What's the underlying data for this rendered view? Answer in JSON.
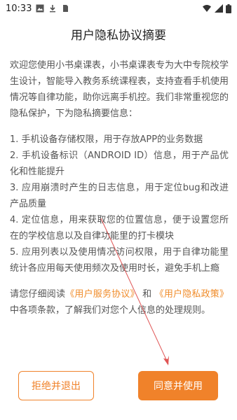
{
  "status_bar": {
    "time": "10:33"
  },
  "dialog": {
    "title": "用户隐私协议摘要",
    "intro": "欢迎您使用小书桌课表，小书桌课表专为大中专院校学生设计，智能导入教务系统课程表，支持查看手机使用情况等自律功能，助你远离手机控。我们非常重视您的隐私保护，下为隐私摘要信息：",
    "items": [
      "1. 手机设备存储权限，用于存放APP的业务数据",
      "2. 手机设备标识（ANDROID ID）信息，用于产品优化和性能提升",
      "3. 应用崩溃时产生的日志信息，用于定位bug和改进产品质量",
      "4. 定位信息，用来获取您的位置信息，便于设置您所在的学校信息以及自律功能里的打卡模块",
      "5. 应用列表以及使用情况访问权限，用于自律功能里统计各应用每天使用频次及使用时长，避免手机上瘾"
    ],
    "agree_prefix": "请您仔细阅读",
    "service_link": "《用户服务协议》",
    "agree_and": " 和 ",
    "privacy_link": "《用户隐私政策》",
    "agree_suffix": "中各项条款，了解我们对您个人信息的处理规则。"
  },
  "buttons": {
    "reject_label": "拒绝并退出",
    "agree_label": "同意并使用"
  },
  "colors": {
    "accent": "#f0822a",
    "annotation": "#e05555"
  }
}
